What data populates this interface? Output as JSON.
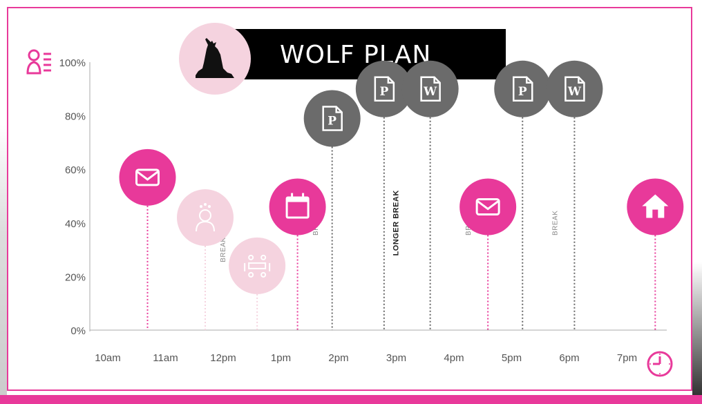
{
  "title": "WOLF PLAN",
  "colors": {
    "accent": "#e8399a",
    "accent_light": "#f5d3df",
    "dark": "#6b6b6b",
    "black": "#000000"
  },
  "icons": {
    "y_axis": "people-list-icon",
    "x_axis": "clock-icon",
    "title": "howling-wolf-icon"
  },
  "chart_data": {
    "type": "scatter",
    "title": "WOLF PLAN",
    "xlabel": "",
    "ylabel": "",
    "x_ticks": [
      "10am",
      "11am",
      "12pm",
      "1pm",
      "2pm",
      "3pm",
      "4pm",
      "5pm",
      "6pm",
      "7pm"
    ],
    "y_ticks": [
      "0%",
      "20%",
      "40%",
      "60%",
      "80%",
      "100%"
    ],
    "ylim": [
      0,
      100
    ],
    "xlim": [
      10,
      20
    ],
    "grid": false,
    "points": [
      {
        "x": 11.0,
        "y": 57,
        "icon": "email-icon",
        "style": "pink"
      },
      {
        "x": 12.0,
        "y": 42,
        "icon": "brainstorm-person-icon",
        "style": "light"
      },
      {
        "x": 12.9,
        "y": 24,
        "icon": "meeting-table-icon",
        "style": "light"
      },
      {
        "x": 13.6,
        "y": 46,
        "icon": "calendar-icon",
        "style": "pink"
      },
      {
        "x": 14.2,
        "y": 79,
        "icon": "powerpoint-file-icon",
        "style": "dark"
      },
      {
        "x": 15.1,
        "y": 90,
        "icon": "powerpoint-file-icon",
        "style": "dark"
      },
      {
        "x": 15.9,
        "y": 90,
        "icon": "word-file-icon",
        "style": "dark"
      },
      {
        "x": 16.9,
        "y": 46,
        "icon": "email-icon",
        "style": "pink"
      },
      {
        "x": 17.5,
        "y": 90,
        "icon": "powerpoint-file-icon",
        "style": "dark"
      },
      {
        "x": 18.4,
        "y": 90,
        "icon": "word-file-icon",
        "style": "dark"
      },
      {
        "x": 19.8,
        "y": 46,
        "icon": "home-icon",
        "style": "pink"
      }
    ],
    "annotations": [
      {
        "x": 12.35,
        "y": 30,
        "text": "BREAK",
        "bold": false
      },
      {
        "x": 13.95,
        "y": 40,
        "text": "BREAK",
        "bold": false
      },
      {
        "x": 15.35,
        "y": 40,
        "text": "LONGER BREAK",
        "bold": true
      },
      {
        "x": 16.6,
        "y": 40,
        "text": "BREAK",
        "bold": false
      },
      {
        "x": 18.1,
        "y": 40,
        "text": "BREAK",
        "bold": false
      }
    ]
  }
}
